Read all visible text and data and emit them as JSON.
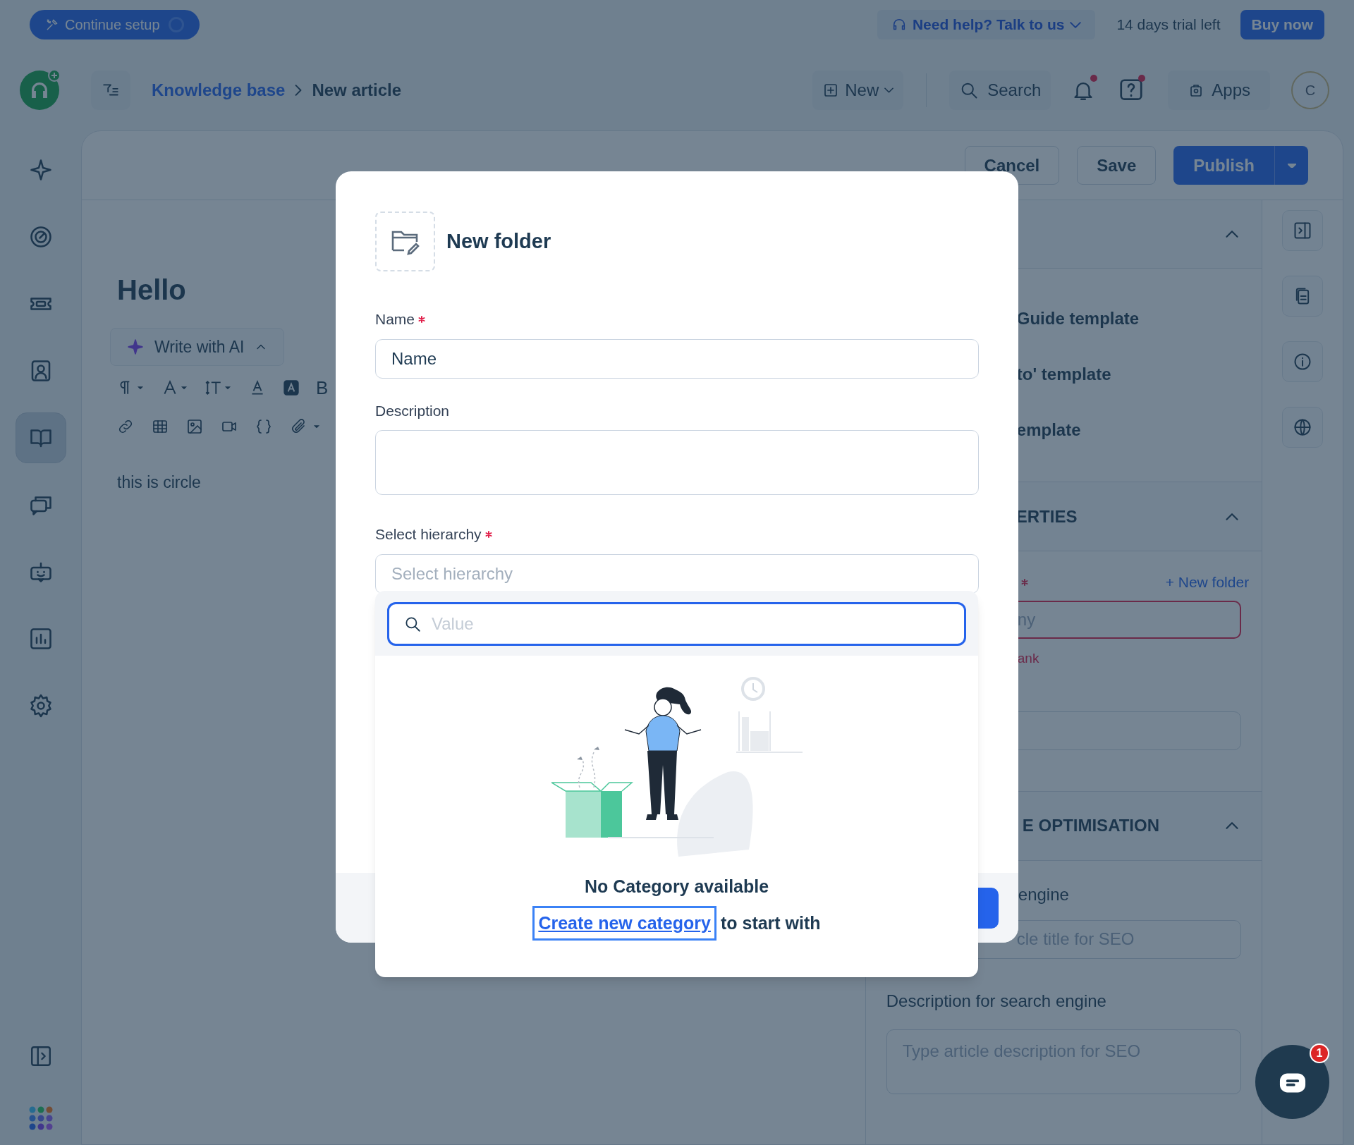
{
  "top_bar": {
    "setup_button": "Continue setup",
    "help_button": "Need help? Talk to us",
    "trial_text": "14 days trial left",
    "buy_button": "Buy now"
  },
  "header": {
    "breadcrumb": [
      {
        "label": "Knowledge base",
        "kind": "link"
      },
      {
        "label": "New article",
        "kind": "current"
      }
    ],
    "new_button": "New",
    "search_button": "Search",
    "notifications": {
      "unread": true
    },
    "help": {
      "unread": true
    },
    "apps_button": "Apps",
    "avatar": "C"
  },
  "sidebar": {
    "items": [
      {
        "selected": false
      },
      {
        "selected": false
      },
      {
        "selected": false
      },
      {
        "selected": false
      },
      {
        "selected": true
      },
      {
        "selected": false
      },
      {
        "selected": false
      },
      {
        "selected": false
      },
      {
        "selected": false
      }
    ]
  },
  "editor": {
    "actions": [
      {
        "label": "Cancel",
        "kind": "secondary"
      },
      {
        "label": "Save",
        "kind": "secondary"
      },
      {
        "label": "Publish",
        "kind": "primary"
      }
    ],
    "title": "Hello",
    "ai_button": "Write with AI",
    "bold_tool": "B",
    "body": "this is circle"
  },
  "right_panel": {
    "templates_section": {
      "expanded": true,
      "items": [
        "Guide template",
        "to' template",
        "emplate"
      ]
    },
    "properties_section": {
      "title": "ERTIES",
      "expanded": true,
      "folder_field": {
        "required": true,
        "new_folder_link": "+ New folder",
        "placeholder": "ny",
        "invalid": true,
        "error": "ank"
      }
    },
    "seo_section": {
      "title": "E OPTIMISATION",
      "expanded": true,
      "title_label": "engine",
      "title_placeholder": "cle title for SEO",
      "description_label": "Description for search engine",
      "description_placeholder": "Type article description for SEO"
    }
  },
  "modal": {
    "title": "New folder",
    "fields": [
      {
        "label": "Name",
        "required": true,
        "kind": "input",
        "value": "Name"
      },
      {
        "label": "Description",
        "required": false,
        "kind": "textarea"
      },
      {
        "label": "Select hierarchy",
        "required": true,
        "kind": "select",
        "placeholder": "Select hierarchy"
      }
    ],
    "dropdown": {
      "search_placeholder": "Value",
      "focused": true,
      "empty_title": "No Category available",
      "create_link": "Create new category",
      "empty_suffix": "to start with"
    }
  },
  "chat": {
    "badge": "1"
  }
}
